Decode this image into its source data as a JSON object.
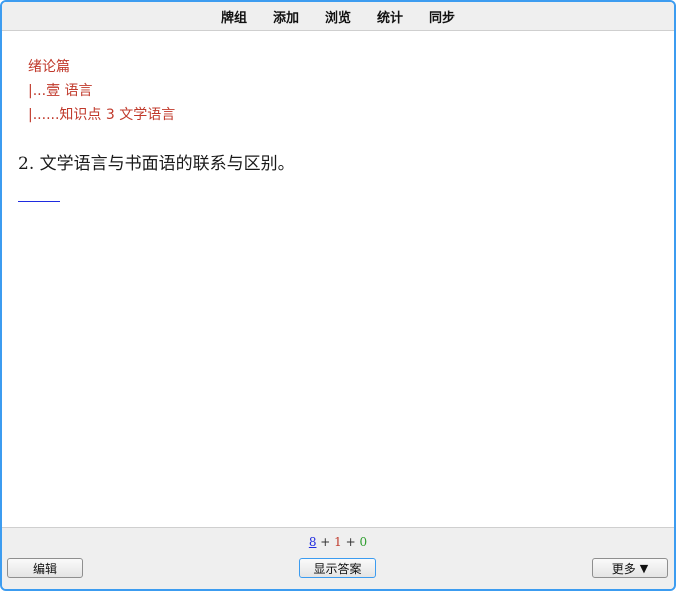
{
  "topbar": {
    "items": [
      {
        "label": "牌组"
      },
      {
        "label": "添加"
      },
      {
        "label": "浏览"
      },
      {
        "label": "统计"
      },
      {
        "label": "同步"
      }
    ]
  },
  "breadcrumb": {
    "line1": "绪论篇",
    "line2": "|...壹 语言",
    "line3": "|......知识点 3 文学语言"
  },
  "card": {
    "question": "2. 文学语言与书面语的联系与区别。"
  },
  "counts": {
    "new": "8",
    "sep1": " + ",
    "learn": "1",
    "sep2": " + ",
    "review": "0"
  },
  "buttons": {
    "edit": "编辑",
    "show_answer": "显示答案",
    "more": "更多",
    "more_arrow": "▼"
  },
  "colors": {
    "accent": "#3c9cf0",
    "breadcrumb": "#c0392b",
    "new": "#1f2be0",
    "learn": "#c0392b",
    "review": "#2e9e2e"
  }
}
